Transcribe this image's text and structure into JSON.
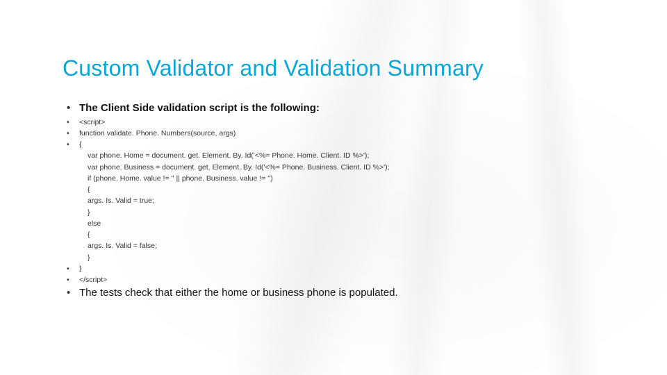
{
  "title": "Custom Validator and Validation Summary",
  "intro": "The Client Side validation script is the following:",
  "code": {
    "open_tag": "<script>",
    "fn_decl": "function validate. Phone. Numbers(source, args)",
    "open_brace": "{",
    "inner_lines": [
      "var phone. Home = document. get. Element. By. Id('<%= Phone. Home. Client. ID %>');",
      "var phone. Business = document. get. Element. By. Id('<%= Phone. Business. Client. ID %>');",
      "if (phone. Home. value != '' || phone. Business. value != '')",
      "{",
      "args. Is. Valid = true;",
      "}",
      "else",
      "{",
      "args. Is. Valid = false;",
      "}"
    ],
    "close_brace": "}",
    "close_tag": "</script>"
  },
  "outro": "The tests check that either the home or business phone is populated."
}
